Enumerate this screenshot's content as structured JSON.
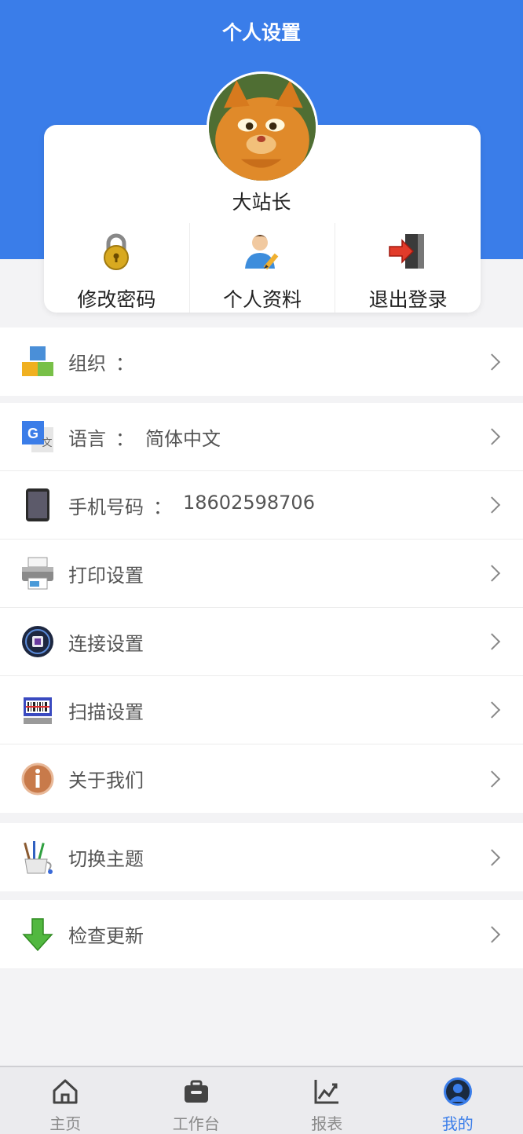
{
  "header": {
    "title": "个人设置"
  },
  "profile": {
    "username": "大站长"
  },
  "actions": [
    {
      "label": "修改密码",
      "icon": "padlock-icon"
    },
    {
      "label": "个人资料",
      "icon": "user-profile-icon"
    },
    {
      "label": "退出登录",
      "icon": "logout-door-icon"
    }
  ],
  "settings": {
    "organization": {
      "label": "组织",
      "sep": "：",
      "value": ""
    },
    "language": {
      "label": "语言",
      "sep": "：",
      "value": "简体中文"
    },
    "phone": {
      "label": "手机号码",
      "sep": "：",
      "value": "18602598706"
    },
    "print": {
      "label": "打印设置"
    },
    "connection": {
      "label": "连接设置"
    },
    "scan": {
      "label": "扫描设置"
    },
    "about": {
      "label": "关于我们"
    },
    "theme": {
      "label": "切换主题"
    },
    "update": {
      "label": "检查更新"
    }
  },
  "tabbar": {
    "tabs": [
      {
        "label": "主页",
        "icon": "home-icon"
      },
      {
        "label": "工作台",
        "icon": "toolbox-icon"
      },
      {
        "label": "报表",
        "icon": "chart-icon"
      },
      {
        "label": "我的",
        "icon": "user-avatar-icon"
      }
    ],
    "active_index": 3
  },
  "colors": {
    "primary": "#3a7de9",
    "background": "#f3f3f5",
    "text": "#444444",
    "inactive_tab": "#8a8a8a"
  }
}
